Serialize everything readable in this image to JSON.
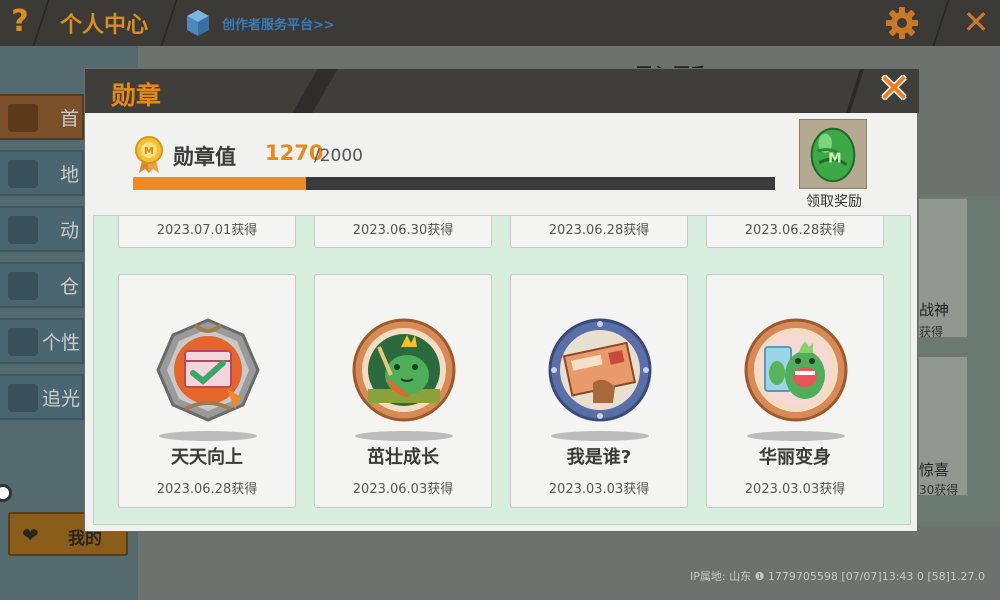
{
  "background": {
    "topbar": {
      "help": "?",
      "title": "个人中心",
      "creator_link": "创作者服务平台>>",
      "close": "✕"
    },
    "sidebar_tabs": [
      "首",
      "地",
      "动",
      "仓",
      "个性",
      "追光"
    ],
    "my_button": "我的",
    "right_cards": [
      {
        "title": "战神",
        "date": "获得"
      },
      {
        "title": "惊喜",
        "date": "30获得"
      }
    ],
    "footer": "IP属地: 山东 ❶    1779705598    [07/07]13:43 0    [58]1.27.0",
    "strip_text": "开心  西瓜"
  },
  "modal": {
    "title": "勋章",
    "close": "✕",
    "medal_label": "勋章值",
    "medal_value": "1270",
    "medal_max": "/2000",
    "progress_fraction": 0.27,
    "reward_label": "领取奖励",
    "top_row": [
      {
        "date": "2023.07.01获得"
      },
      {
        "date": "2023.06.30获得"
      },
      {
        "date": "2023.06.28获得"
      },
      {
        "date": "2023.06.28获得"
      }
    ],
    "badges": [
      {
        "name": "天天向上",
        "date": "2023.06.28获得",
        "icon": "calendar-checkmark-badge-icon"
      },
      {
        "name": "茁壮成长",
        "date": "2023.06.03获得",
        "icon": "frog-king-badge-icon"
      },
      {
        "name": "我是谁?",
        "date": "2023.03.03获得",
        "icon": "envelope-badge-icon"
      },
      {
        "name": "华丽变身",
        "date": "2023.03.03获得",
        "icon": "dinosaur-costume-badge-icon"
      }
    ]
  }
}
